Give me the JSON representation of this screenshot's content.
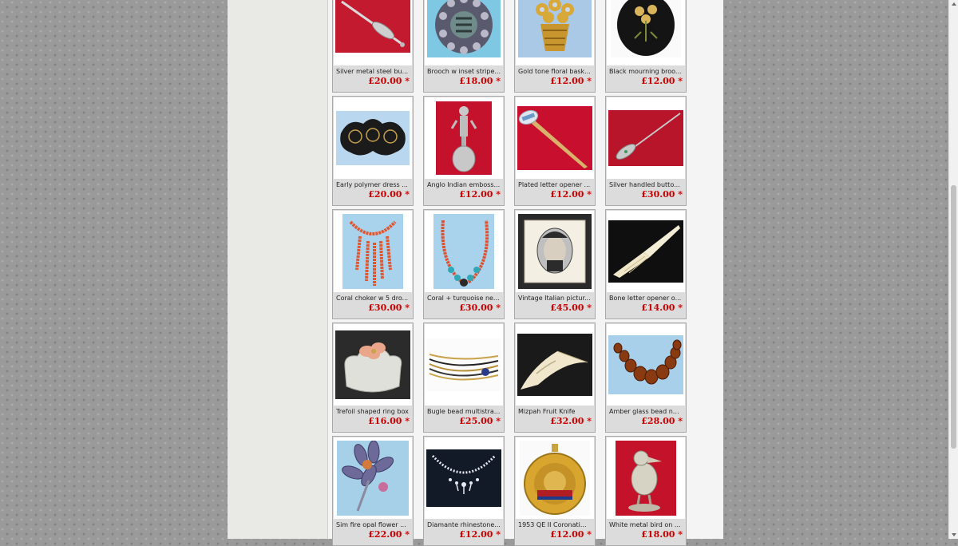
{
  "products": [
    {
      "name": "Silver metal steel bu...",
      "price": "£20.00",
      "marker": "*",
      "image": "silver-steel-button-hook"
    },
    {
      "name": "Brooch w inset stripe...",
      "price": "£18.00",
      "marker": "*",
      "image": "brooch-inset-stripe"
    },
    {
      "name": "Gold tone floral bask...",
      "price": "£12.00",
      "marker": "*",
      "image": "gold-floral-basket-brooch"
    },
    {
      "name": "Black mourning broo...",
      "price": "£12.00",
      "marker": "*",
      "image": "black-mourning-brooch"
    },
    {
      "name": "Early polymer dress ...",
      "price": "£20.00",
      "marker": "*",
      "image": "polymer-dress-clips"
    },
    {
      "name": "Anglo Indian emboss...",
      "price": "£12.00",
      "marker": "*",
      "image": "anglo-indian-spoon"
    },
    {
      "name": "Plated letter opener ...",
      "price": "£12.00",
      "marker": "*",
      "image": "plated-letter-opener"
    },
    {
      "name": "Silver handled butto...",
      "price": "£30.00",
      "marker": "*",
      "image": "silver-button-hook"
    },
    {
      "name": "Coral choker w 5 dro...",
      "price": "£30.00",
      "marker": "*",
      "image": "coral-choker"
    },
    {
      "name": "Coral + turquoise ne...",
      "price": "£30.00",
      "marker": "*",
      "image": "coral-turquoise-necklace"
    },
    {
      "name": "Vintage Italian pictur...",
      "price": "£45.00",
      "marker": "*",
      "image": "italian-picture-frame"
    },
    {
      "name": "Bone letter opener o...",
      "price": "£14.00",
      "marker": "*",
      "image": "bone-letter-opener"
    },
    {
      "name": "Trefoil shaped ring box",
      "price": "£16.00",
      "marker": "*",
      "image": "trefoil-ring-box"
    },
    {
      "name": "Bugle bead multistra...",
      "price": "£25.00",
      "marker": "*",
      "image": "bugle-bead-necklace"
    },
    {
      "name": "Mizpah Fruit Knife",
      "price": "£32.00",
      "marker": "*",
      "image": "mizpah-fruit-knife"
    },
    {
      "name": "Amber glass bead ne...",
      "price": "£28.00",
      "marker": "*",
      "image": "amber-bead-necklace"
    },
    {
      "name": "Sim fire opal flower ...",
      "price": "£22.00",
      "marker": "*",
      "image": "fire-opal-flower-brooch"
    },
    {
      "name": "Diamante rhinestone...",
      "price": "£12.00",
      "marker": "*",
      "image": "diamante-necklace"
    },
    {
      "name": "1953 QE II Coronati...",
      "price": "£12.00",
      "marker": "*",
      "image": "coronation-medal"
    },
    {
      "name": "White metal bird on ...",
      "price": "£18.00",
      "marker": "*",
      "image": "metal-bird-figure"
    }
  ]
}
